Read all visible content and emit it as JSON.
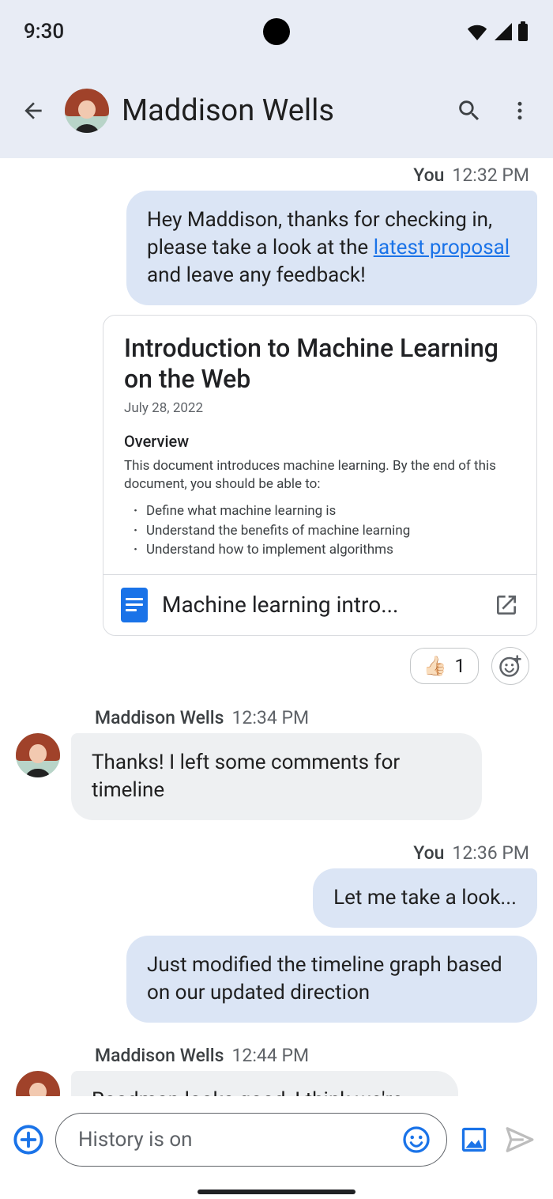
{
  "status": {
    "time": "9:30"
  },
  "header": {
    "contact_name": "Maddison Wells"
  },
  "thread": {
    "m1": {
      "sender": "You",
      "time": "12:32 PM",
      "text_pre": "Hey Maddison, thanks for checking in, please take a look at the ",
      "link": "latest proposal",
      "text_post": " and leave any feedback!"
    },
    "card": {
      "title": "Introduction to Machine Learning on the Web",
      "date": "July 28, 2022",
      "heading": "Overview",
      "desc": "This document introduces machine learning. By the end of this document, you should be able to:",
      "bullets": {
        "0": "Define what machine learning is",
        "1": "Understand the benefits of machine learning",
        "2": "Understand how to implement algorithms"
      },
      "file_name": "Machine learning intro..."
    },
    "reaction": {
      "emoji": "👍🏻",
      "count": "1"
    },
    "m2": {
      "sender": "Maddison Wells",
      "time": "12:34 PM",
      "text": "Thanks! I left some comments for timeline"
    },
    "m3": {
      "sender": "You",
      "time": "12:36 PM",
      "text_a": "Let me take a look...",
      "text_b": "Just modified the timeline graph based on our updated direction"
    },
    "m4": {
      "sender": "Maddison Wells",
      "time": "12:44 PM",
      "text": "Roadmap looks good, I think we're ready for the next review. Thanks Ann!"
    }
  },
  "composer": {
    "placeholder": "History is on"
  }
}
